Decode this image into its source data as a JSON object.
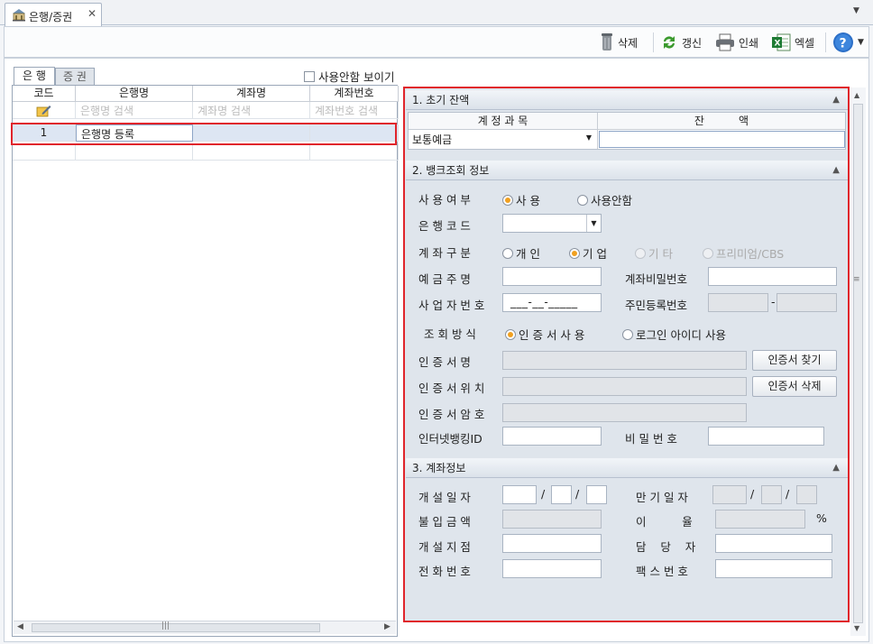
{
  "doc_tab": {
    "title": "은행/증권",
    "close": "✕"
  },
  "toolbar": {
    "delete": "삭제",
    "refresh": "갱신",
    "print": "인쇄",
    "excel": "엑셀"
  },
  "subtabs": {
    "bank": "은 행",
    "securities": "증 권"
  },
  "show_unused": "사용안함 보이기",
  "grid": {
    "columns": [
      "코드",
      "은행명",
      "계좌명",
      "계좌번호"
    ],
    "filters": [
      "은행명 검색",
      "계좌명 검색",
      "계좌번호 검색"
    ],
    "rows": [
      {
        "code": "1",
        "bank": "은행명 등록",
        "account_name": "",
        "account_no": ""
      }
    ]
  },
  "section1": {
    "title": "1. 초기 잔액",
    "col_account": "계 정 과 목",
    "col_balance": "잔          액",
    "account_value": "보통예금"
  },
  "section2": {
    "title": "2. 뱅크조회 정보",
    "use_label": "사 용 여 부",
    "use_yes": "사 용",
    "use_no": "사용안함",
    "bank_code_label": "은 행 코 드",
    "acct_type_label": "계 좌 구 분",
    "type_personal": "개 인",
    "type_corp": "기 업",
    "type_other": "기 타",
    "type_premium": "프리미엄/CBS",
    "holder_label": "예 금 주 명",
    "acct_pw_label": "계좌비밀번호",
    "biz_no_label": "사 업 자 번 호",
    "biz_no_mask": "___-__-_____",
    "resident_label": "주민등록번호",
    "resident_sep": "-",
    "query_label": "조 회 방 식",
    "query_cert": "인 증 서 사 용",
    "query_login": "로그인 아이디 사용",
    "cert_name_label": "인 증 서 명",
    "cert_find": "인증서 찾기",
    "cert_loc_label": "인 증 서 위 치",
    "cert_delete": "인증서 삭제",
    "cert_pw_label": "인 증 서 암 호",
    "ib_id_label": "인터넷뱅킹ID",
    "pw_label": "비 밀 번 호"
  },
  "section3": {
    "title": "3. 계좌정보",
    "open_date_label": "개 설 일 자",
    "maturity_label": "만 기 일 자",
    "deposit_label": "불 입 금 액",
    "rate_label": "이          율",
    "rate_unit": "%",
    "branch_label": "개 설 지 점",
    "manager_label": "담    당    자",
    "phone_label": "전 화 번 호",
    "fax_label": "팩 스 번 호",
    "date_sep": "/"
  }
}
